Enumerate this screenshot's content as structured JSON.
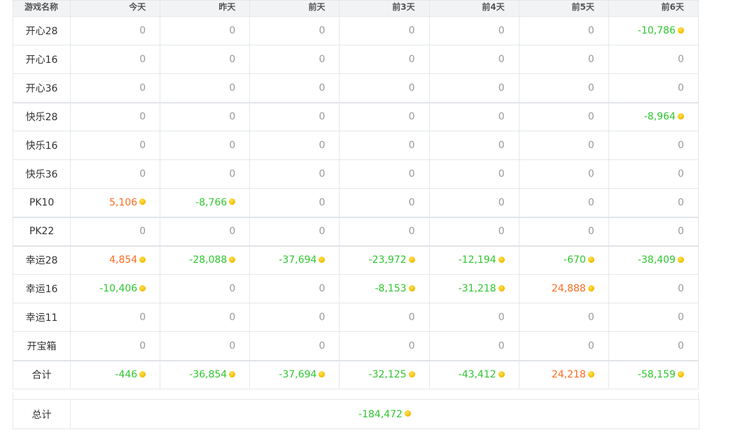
{
  "headers": [
    "游戏名称",
    "今天",
    "昨天",
    "前天",
    "前3天",
    "前4天",
    "前5天",
    "前6天"
  ],
  "rows": [
    {
      "name": "开心28",
      "cells": [
        {
          "v": "0",
          "t": "zero"
        },
        {
          "v": "0",
          "t": "zero"
        },
        {
          "v": "0",
          "t": "zero"
        },
        {
          "v": "0",
          "t": "zero"
        },
        {
          "v": "0",
          "t": "zero"
        },
        {
          "v": "0",
          "t": "zero"
        },
        {
          "v": "-10,786",
          "t": "neg"
        }
      ]
    },
    {
      "name": "开心16",
      "cells": [
        {
          "v": "0",
          "t": "zero"
        },
        {
          "v": "0",
          "t": "zero"
        },
        {
          "v": "0",
          "t": "zero"
        },
        {
          "v": "0",
          "t": "zero"
        },
        {
          "v": "0",
          "t": "zero"
        },
        {
          "v": "0",
          "t": "zero"
        },
        {
          "v": "0",
          "t": "zero"
        }
      ]
    },
    {
      "name": "开心36",
      "cells": [
        {
          "v": "0",
          "t": "zero"
        },
        {
          "v": "0",
          "t": "zero"
        },
        {
          "v": "0",
          "t": "zero"
        },
        {
          "v": "0",
          "t": "zero"
        },
        {
          "v": "0",
          "t": "zero"
        },
        {
          "v": "0",
          "t": "zero"
        },
        {
          "v": "0",
          "t": "zero"
        }
      ]
    },
    {
      "name": "快乐28",
      "group_start": true,
      "cells": [
        {
          "v": "0",
          "t": "zero"
        },
        {
          "v": "0",
          "t": "zero"
        },
        {
          "v": "0",
          "t": "zero"
        },
        {
          "v": "0",
          "t": "zero"
        },
        {
          "v": "0",
          "t": "zero"
        },
        {
          "v": "0",
          "t": "zero"
        },
        {
          "v": "-8,964",
          "t": "neg"
        }
      ]
    },
    {
      "name": "快乐16",
      "cells": [
        {
          "v": "0",
          "t": "zero"
        },
        {
          "v": "0",
          "t": "zero"
        },
        {
          "v": "0",
          "t": "zero"
        },
        {
          "v": "0",
          "t": "zero"
        },
        {
          "v": "0",
          "t": "zero"
        },
        {
          "v": "0",
          "t": "zero"
        },
        {
          "v": "0",
          "t": "zero"
        }
      ]
    },
    {
      "name": "快乐36",
      "cells": [
        {
          "v": "0",
          "t": "zero"
        },
        {
          "v": "0",
          "t": "zero"
        },
        {
          "v": "0",
          "t": "zero"
        },
        {
          "v": "0",
          "t": "zero"
        },
        {
          "v": "0",
          "t": "zero"
        },
        {
          "v": "0",
          "t": "zero"
        },
        {
          "v": "0",
          "t": "zero"
        }
      ]
    },
    {
      "name": "PK10",
      "cells": [
        {
          "v": "5,106",
          "t": "pos"
        },
        {
          "v": "-8,766",
          "t": "neg"
        },
        {
          "v": "0",
          "t": "zero"
        },
        {
          "v": "0",
          "t": "zero"
        },
        {
          "v": "0",
          "t": "zero"
        },
        {
          "v": "0",
          "t": "zero"
        },
        {
          "v": "0",
          "t": "zero"
        }
      ]
    },
    {
      "name": "PK22",
      "group_start": true,
      "cells": [
        {
          "v": "0",
          "t": "zero"
        },
        {
          "v": "0",
          "t": "zero"
        },
        {
          "v": "0",
          "t": "zero"
        },
        {
          "v": "0",
          "t": "zero"
        },
        {
          "v": "0",
          "t": "zero"
        },
        {
          "v": "0",
          "t": "zero"
        },
        {
          "v": "0",
          "t": "zero"
        }
      ]
    },
    {
      "name": "幸运28",
      "group_start": true,
      "cells": [
        {
          "v": "4,854",
          "t": "pos"
        },
        {
          "v": "-28,088",
          "t": "neg"
        },
        {
          "v": "-37,694",
          "t": "neg"
        },
        {
          "v": "-23,972",
          "t": "neg"
        },
        {
          "v": "-12,194",
          "t": "neg"
        },
        {
          "v": "-670",
          "t": "neg"
        },
        {
          "v": "-38,409",
          "t": "neg"
        }
      ]
    },
    {
      "name": "幸运16",
      "cells": [
        {
          "v": "-10,406",
          "t": "neg"
        },
        {
          "v": "0",
          "t": "zero"
        },
        {
          "v": "0",
          "t": "zero"
        },
        {
          "v": "-8,153",
          "t": "neg"
        },
        {
          "v": "-31,218",
          "t": "neg"
        },
        {
          "v": "24,888",
          "t": "pos"
        },
        {
          "v": "0",
          "t": "zero"
        }
      ]
    },
    {
      "name": "幸运11",
      "cells": [
        {
          "v": "0",
          "t": "zero"
        },
        {
          "v": "0",
          "t": "zero"
        },
        {
          "v": "0",
          "t": "zero"
        },
        {
          "v": "0",
          "t": "zero"
        },
        {
          "v": "0",
          "t": "zero"
        },
        {
          "v": "0",
          "t": "zero"
        },
        {
          "v": "0",
          "t": "zero"
        }
      ]
    },
    {
      "name": "开宝箱",
      "cells": [
        {
          "v": "0",
          "t": "zero"
        },
        {
          "v": "0",
          "t": "zero"
        },
        {
          "v": "0",
          "t": "zero"
        },
        {
          "v": "0",
          "t": "zero"
        },
        {
          "v": "0",
          "t": "zero"
        },
        {
          "v": "0",
          "t": "zero"
        },
        {
          "v": "0",
          "t": "zero"
        }
      ]
    },
    {
      "name": "合计",
      "group_start": true,
      "cells": [
        {
          "v": "-446",
          "t": "neg"
        },
        {
          "v": "-36,854",
          "t": "neg"
        },
        {
          "v": "-37,694",
          "t": "neg"
        },
        {
          "v": "-32,125",
          "t": "neg"
        },
        {
          "v": "-43,412",
          "t": "neg"
        },
        {
          "v": "24,218",
          "t": "pos"
        },
        {
          "v": "-58,159",
          "t": "neg"
        }
      ]
    }
  ],
  "total": {
    "label": "总计",
    "value": "-184,472",
    "t": "neg"
  },
  "colors": {
    "negative": "#2fc72f",
    "positive": "#ff6a20",
    "zero": "#999999",
    "coin": "#f5c000"
  },
  "icons": {
    "coin": "gold-coin-icon"
  }
}
